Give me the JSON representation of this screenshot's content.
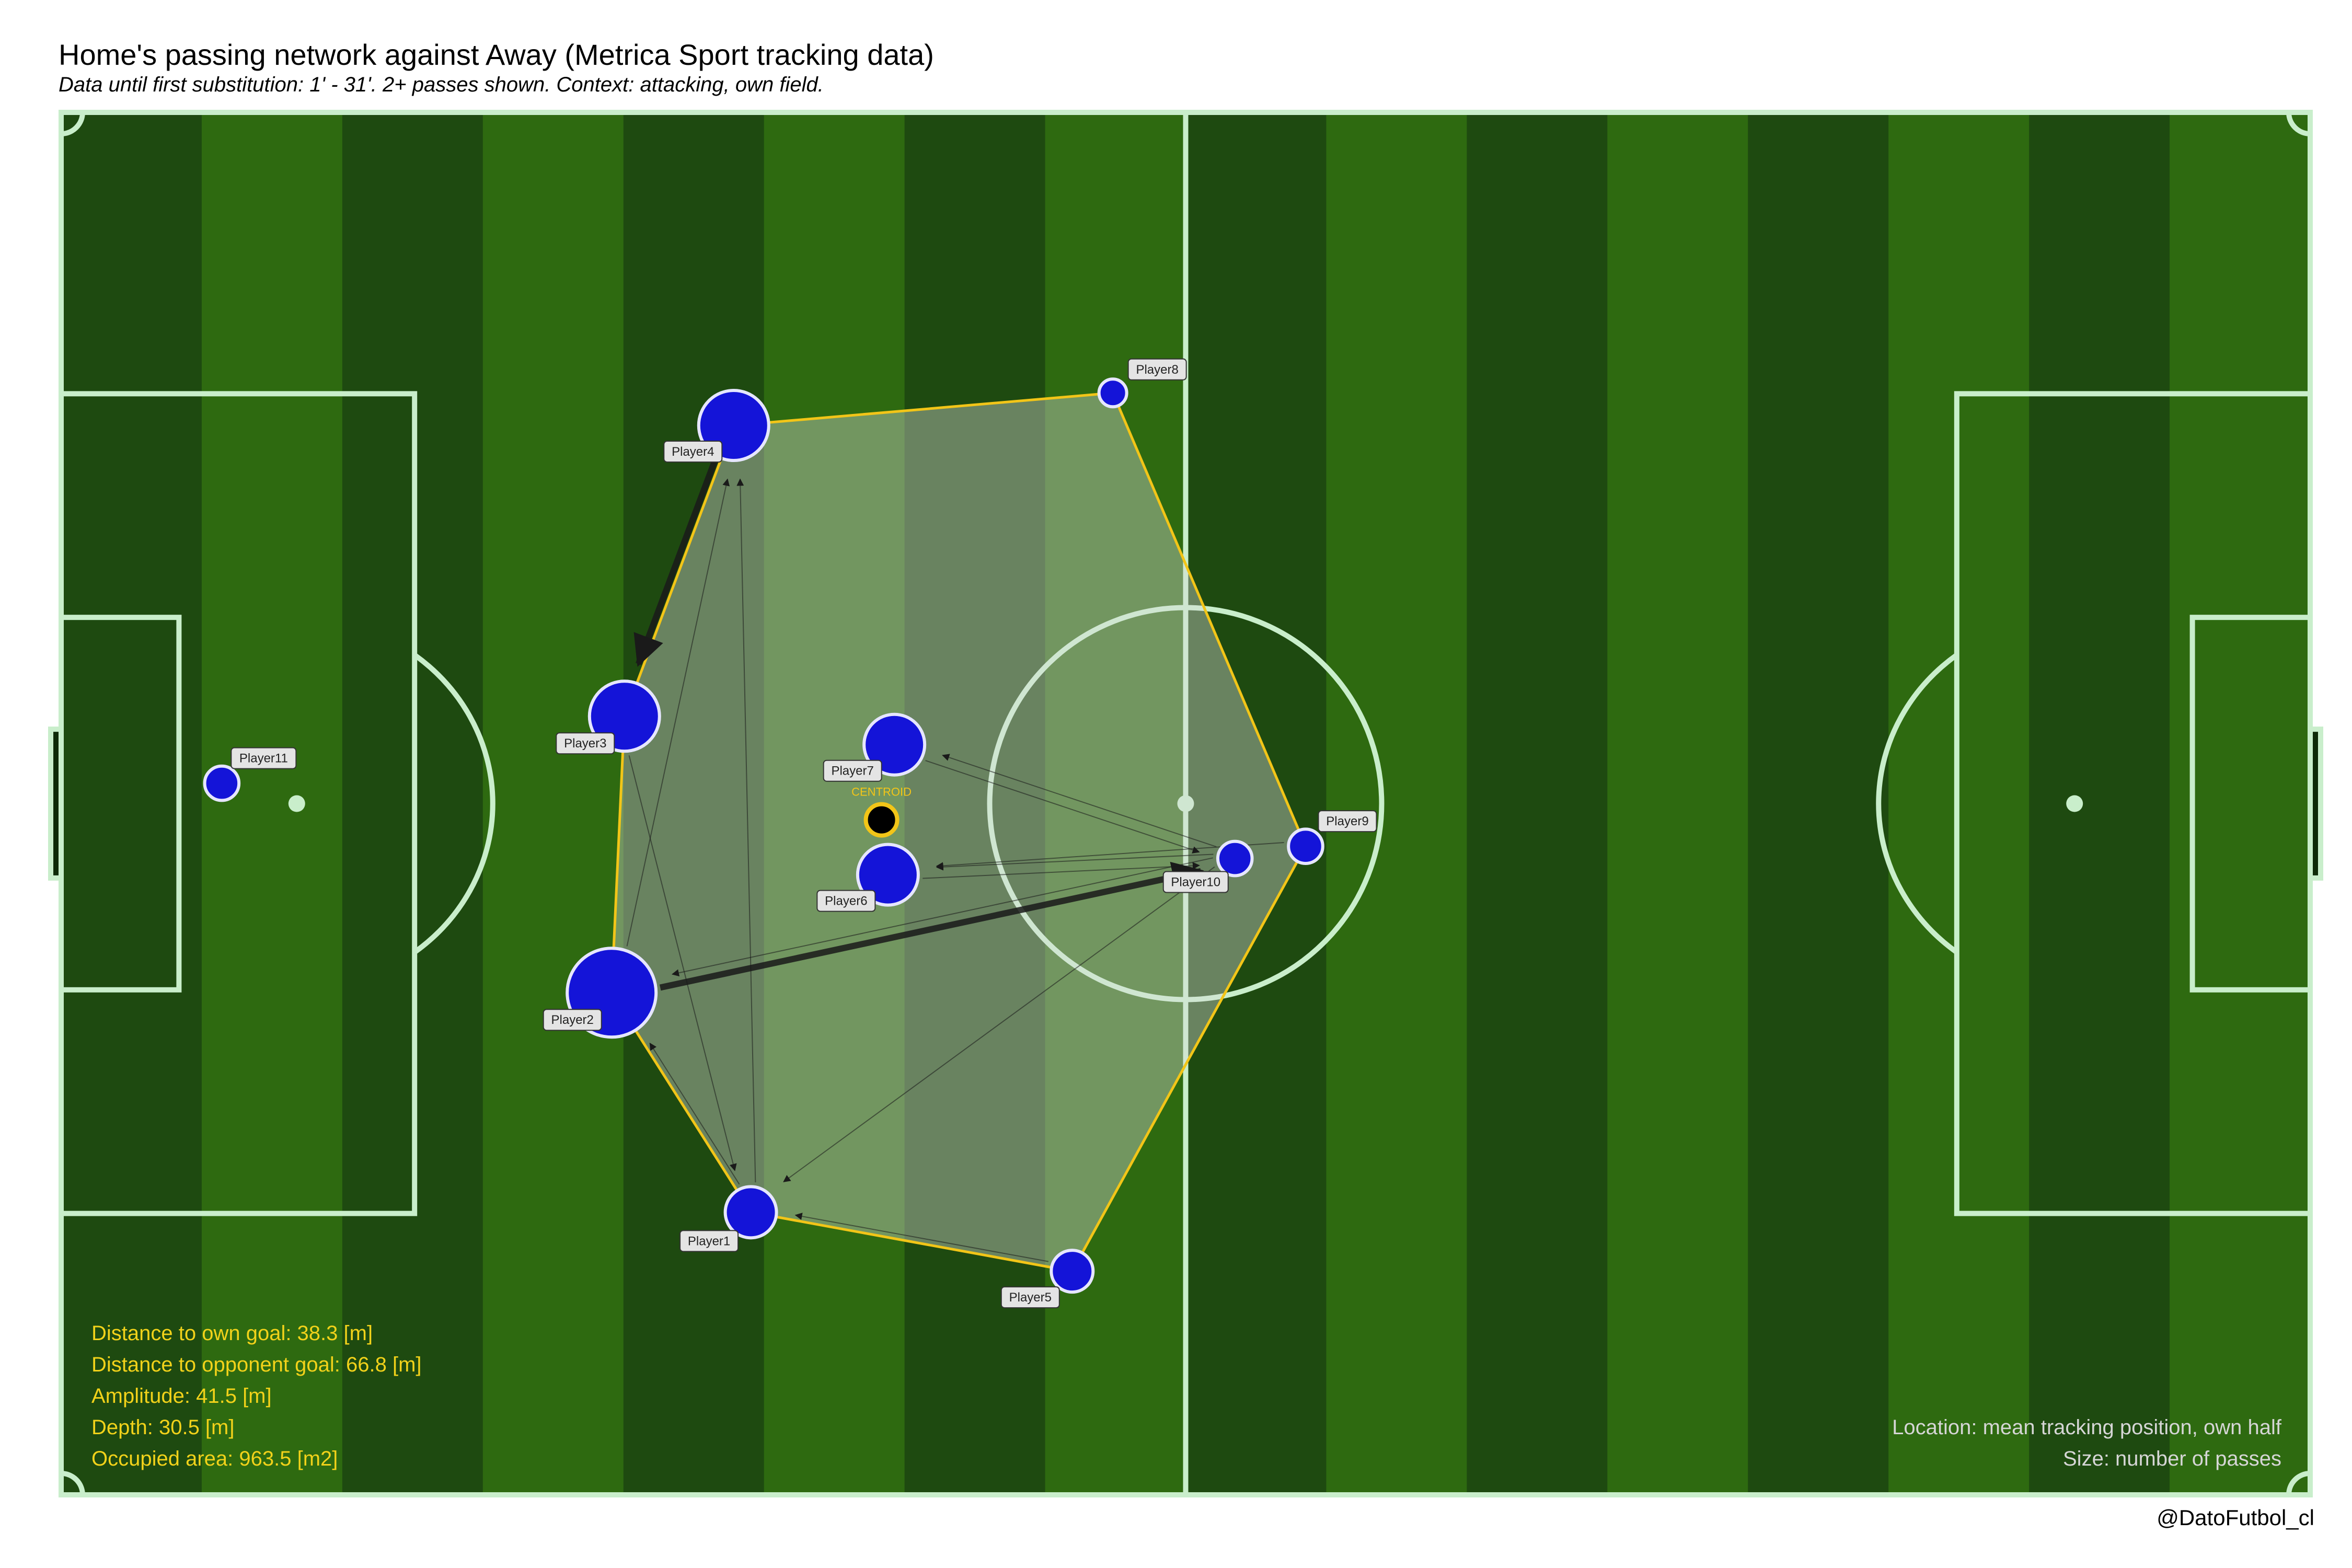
{
  "title": "Home's passing network against Away (Metrica Sport tracking data)",
  "subtitle": "Data until first substitution: 1' - 31'. 2+ passes shown. Context: attacking, own field.",
  "credit": "@DatoFutbol_cl",
  "colors": {
    "grass_dark": "#1e4a10",
    "grass_light": "#2e6a10",
    "line": "#c9eecb",
    "node": "#1414d8",
    "hull": "#f2c518",
    "hull_fill": "#d9d9d9",
    "stat_text": "#f2d21a",
    "note_text": "#d6d6d6",
    "centroid": "#000000"
  },
  "stats": [
    "Distance to own goal: 38.3 [m]",
    "Distance to opponent goal: 66.8 [m]",
    "Amplitude: 41.5 [m]",
    "Depth: 30.5 [m]",
    "Occupied area: 963.5 [m2]"
  ],
  "notes": [
    "Location: mean tracking position, own half",
    "Size: number of passes"
  ],
  "centroid_label": "CENTROID",
  "chart_data": {
    "type": "network",
    "pitch_m": [
      105,
      68
    ],
    "players": [
      {
        "name": "Player1",
        "x": 32.2,
        "y": 13.9,
        "size": 3
      },
      {
        "name": "Player2",
        "x": 25.7,
        "y": 24.7,
        "size": 7
      },
      {
        "name": "Player3",
        "x": 26.3,
        "y": 38.3,
        "size": 5
      },
      {
        "name": "Player4",
        "x": 31.4,
        "y": 52.6,
        "size": 5
      },
      {
        "name": "Player5",
        "x": 47.2,
        "y": 11.0,
        "size": 2
      },
      {
        "name": "Player6",
        "x": 38.6,
        "y": 30.5,
        "size": 4
      },
      {
        "name": "Player7",
        "x": 38.9,
        "y": 36.9,
        "size": 4
      },
      {
        "name": "Player8",
        "x": 49.1,
        "y": 54.2,
        "size": 0.5
      },
      {
        "name": "Player9",
        "x": 58.1,
        "y": 31.9,
        "size": 1.2
      },
      {
        "name": "Player10",
        "x": 54.8,
        "y": 31.3,
        "size": 1.2
      },
      {
        "name": "Player11",
        "x": 7.5,
        "y": 35.0,
        "size": 1.2
      }
    ],
    "centroid": {
      "x": 38.3,
      "y": 33.2
    },
    "hull_order": [
      "Player4",
      "Player8",
      "Player9",
      "Player5",
      "Player1",
      "Player2",
      "Player3"
    ],
    "passes": [
      {
        "from": "Player2",
        "to": "Player10",
        "count": 6
      },
      {
        "from": "Player4",
        "to": "Player3",
        "count": 5
      },
      {
        "from": "Player10",
        "to": "Player2",
        "count": 2
      },
      {
        "from": "Player10",
        "to": "Player6",
        "count": 2
      },
      {
        "from": "Player6",
        "to": "Player10",
        "count": 2
      },
      {
        "from": "Player10",
        "to": "Player7",
        "count": 2
      },
      {
        "from": "Player7",
        "to": "Player10",
        "count": 2
      },
      {
        "from": "Player5",
        "to": "Player1",
        "count": 2
      },
      {
        "from": "Player1",
        "to": "Player2",
        "count": 2
      },
      {
        "from": "Player3",
        "to": "Player1",
        "count": 2
      },
      {
        "from": "Player1",
        "to": "Player4",
        "count": 2
      },
      {
        "from": "Player2",
        "to": "Player4",
        "count": 2
      },
      {
        "from": "Player10",
        "to": "Player1",
        "count": 2
      },
      {
        "from": "Player9",
        "to": "Player6",
        "count": 2
      }
    ]
  }
}
